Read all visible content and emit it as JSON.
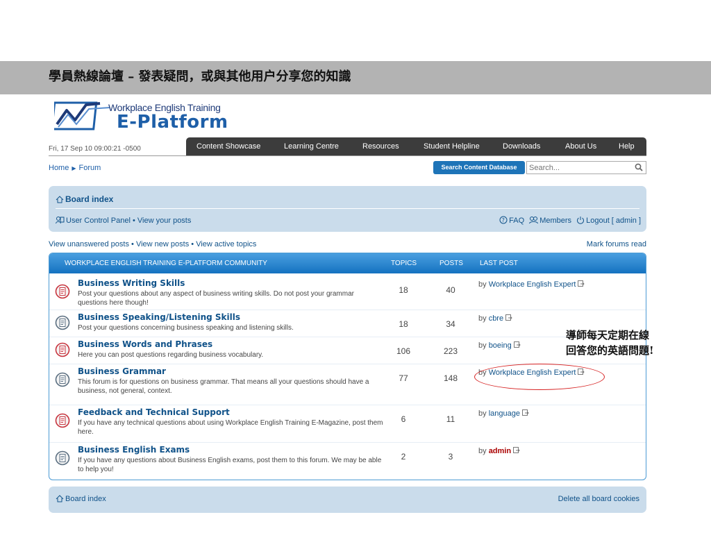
{
  "slide": {
    "title": "學員熱線論壇 – 發表疑問，或與其他用户分享您的知識"
  },
  "logo": {
    "tagline": "Workplace English Training",
    "name": "E-Platform"
  },
  "header": {
    "datetime": "Fri, 17 Sep 10 09:00:21 -0500",
    "nav": [
      "Content Showcase",
      "Learning Centre",
      "Resources",
      "Student Helpline",
      "Downloads",
      "About Us",
      "Help"
    ]
  },
  "breadcrumb": {
    "home": "Home",
    "current": "Forum"
  },
  "search": {
    "button_label": "Search Content Database",
    "placeholder": "Search..."
  },
  "board_panel": {
    "title": "Board index",
    "ucp": "User Control Panel",
    "bullet": "•",
    "view_posts": "View your posts",
    "faq": "FAQ",
    "members": "Members",
    "logout": "Logout [ admin ]"
  },
  "quicklinks": {
    "unanswered": "View unanswered posts",
    "new_posts": "View new posts",
    "active": "View active topics",
    "mark_read": "Mark forums read"
  },
  "forum_table": {
    "category": "WORKPLACE ENGLISH TRAINING E-PLATFORM COMMUNITY",
    "col_topics": "TOPICS",
    "col_posts": "POSTS",
    "col_last_post": "LAST POST",
    "by_word": "by",
    "rows": [
      {
        "name": "Business Writing Skills",
        "desc": "Post your questions about any aspect of business writing skills. Do not post your grammar questions here though!",
        "topics": "18",
        "posts": "40",
        "last_by": "Workplace English Expert",
        "status": "unread"
      },
      {
        "name": "Business Speaking/Listening Skills",
        "desc": "Post your questions concerning business speaking and listening skills.",
        "topics": "18",
        "posts": "34",
        "last_by": "cbre",
        "status": "read"
      },
      {
        "name": "Business Words and Phrases",
        "desc": "Here you can post questions regarding business vocabulary.",
        "topics": "106",
        "posts": "223",
        "last_by": "boeing",
        "status": "unread"
      },
      {
        "name": "Business Grammar",
        "desc": "This forum is for questions on business grammar. That means all your questions should have a business, not general, context.",
        "topics": "77",
        "posts": "148",
        "last_by": "Workplace English Expert",
        "status": "read"
      },
      {
        "name": "Feedback and Technical Support",
        "desc": "If you have any technical questions about using Workplace English Training E-Magazine, post them here.",
        "topics": "6",
        "posts": "11",
        "last_by": "language",
        "status": "unread"
      },
      {
        "name": "Business English Exams",
        "desc": "If you have any questions about Business English exams, post them to this forum. We may be able to help you!",
        "topics": "2",
        "posts": "3",
        "last_by": "admin",
        "status": "read"
      }
    ]
  },
  "annotation": {
    "line1": "導師每天定期在線",
    "line2": "回答您的英語問題!"
  },
  "footer": {
    "board_index": "Board index",
    "delete_cookies": "Delete all board cookies"
  },
  "colors": {
    "banner": "#b3b3b3",
    "nav_bg": "#3c3c3c",
    "link_blue": "#105289",
    "panel_bg": "#cadceb",
    "table_header": "#1e7cc8",
    "unread_icon": "#c8323c",
    "read_icon": "#5a6e80",
    "highlight": "#d62020"
  }
}
